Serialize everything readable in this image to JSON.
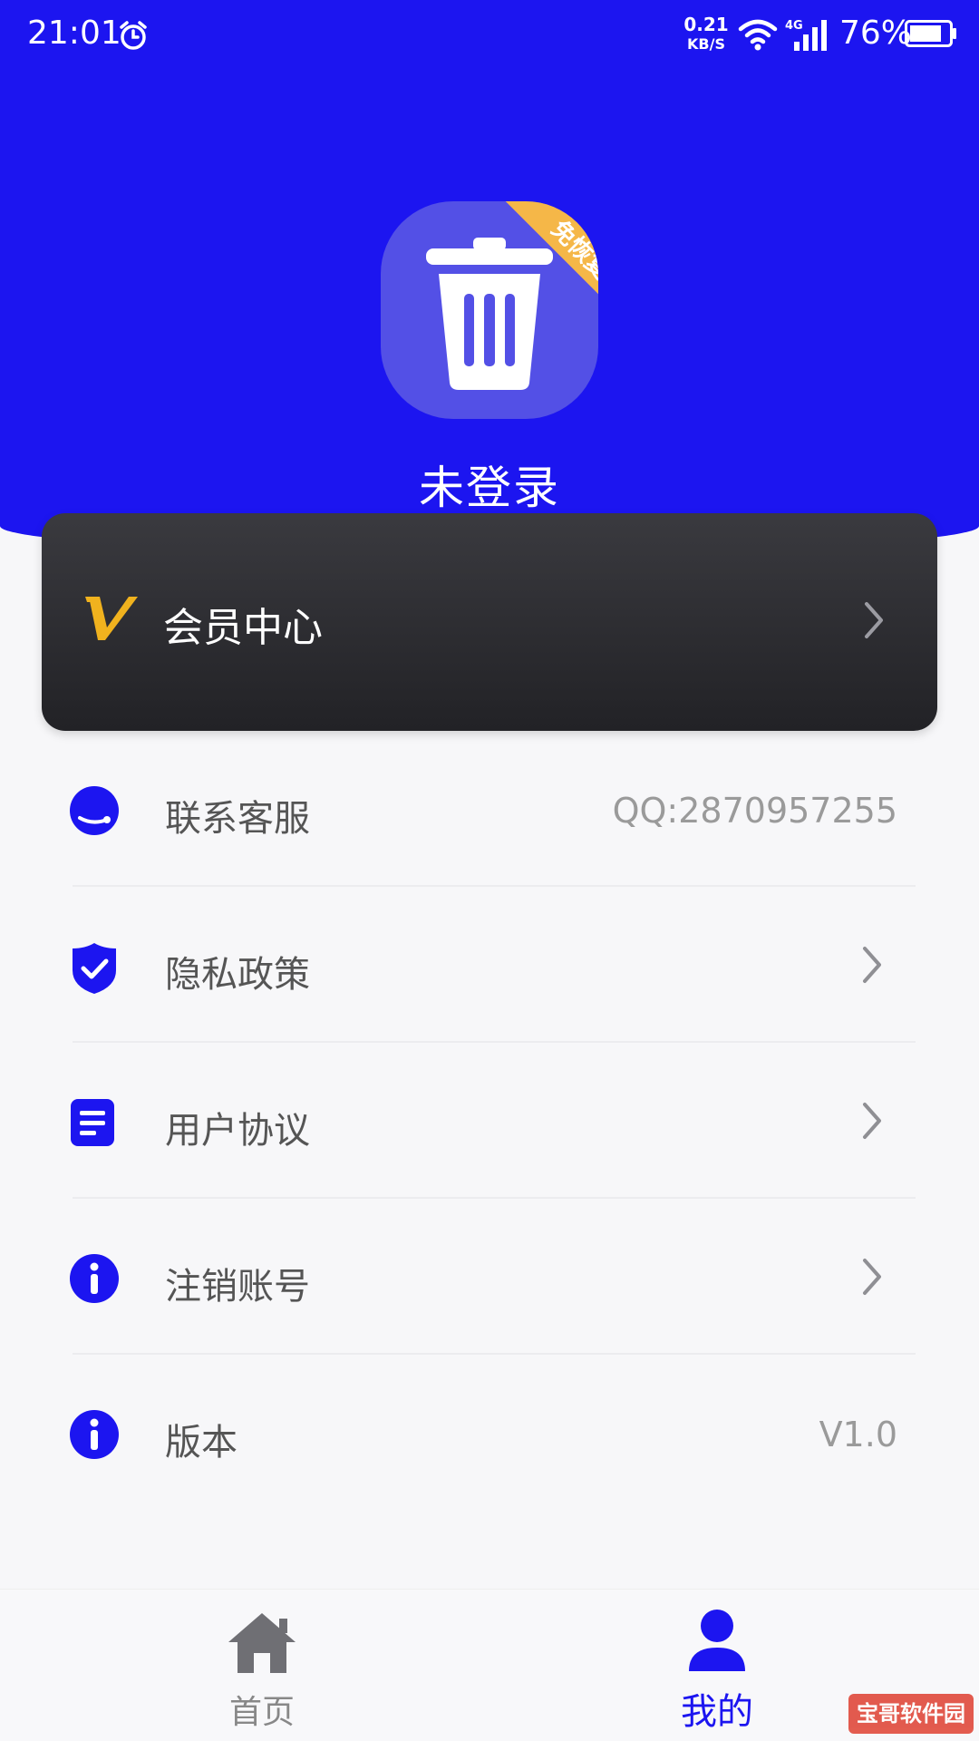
{
  "status_bar": {
    "time": "21:01",
    "net_speed_value": "0.21",
    "net_speed_unit": "KB/S",
    "network_type": "4G",
    "battery_percent": "76%"
  },
  "profile": {
    "logo_badge": "免恢复",
    "login_status": "未登录"
  },
  "vip": {
    "label": "会员中心"
  },
  "menu": {
    "items": [
      {
        "label": "联系客服",
        "value": "QQ:2870957255",
        "icon": "headset-icon"
      },
      {
        "label": "隐私政策",
        "icon": "shield-check-icon"
      },
      {
        "label": "用户协议",
        "icon": "document-icon"
      },
      {
        "label": "注销账号",
        "icon": "info-icon"
      },
      {
        "label": "版本",
        "value": "V1.0",
        "icon": "info-icon"
      }
    ]
  },
  "bottom_nav": {
    "home_label": "首页",
    "mine_label": "我的"
  },
  "watermark": "宝哥软件园",
  "colors": {
    "primary": "#1c15f0",
    "badge": "#f5b748",
    "vip_gold": "#f0b21e",
    "vip_card": "#2a2a2e"
  }
}
